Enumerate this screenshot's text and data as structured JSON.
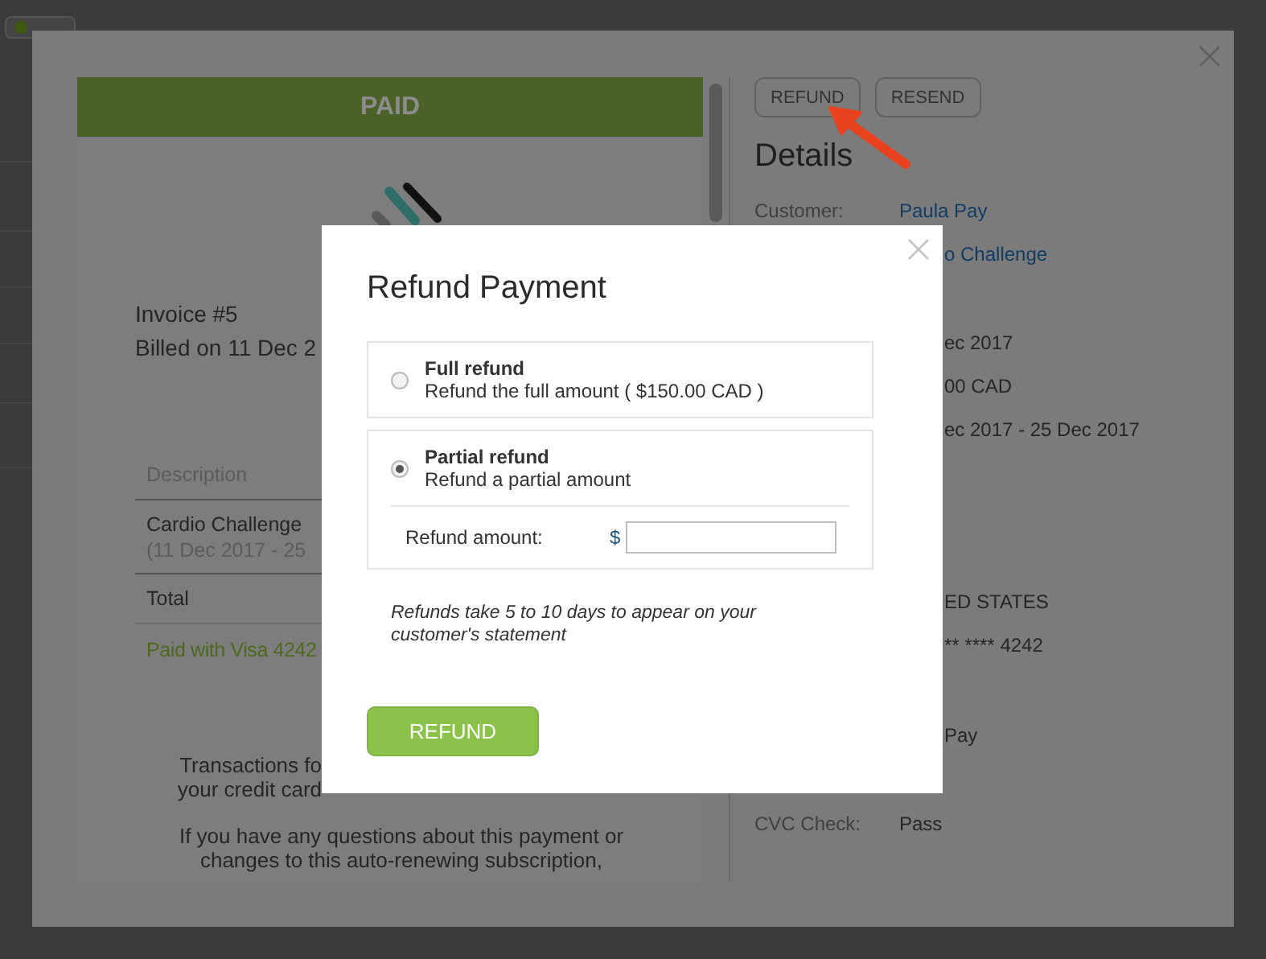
{
  "invoice": {
    "status": "PAID",
    "number": "Invoice #5",
    "billed": "Billed on 11 Dec 2",
    "table": {
      "header": "Description",
      "items": [
        {
          "name": "Cardio Challenge",
          "period": "(11 Dec 2017 - 25"
        }
      ],
      "total_label": "Total"
    },
    "payment": "Paid with Visa 4242",
    "footer": [
      [
        "Transactions fo",
        "your credit card"
      ],
      [
        "If you have any questions about this payment or",
        "changes to this auto-renewing subscription,"
      ]
    ]
  },
  "details_panel": {
    "actions": [
      "REFUND",
      "RESEND"
    ],
    "title": "Details",
    "groups": [
      [
        {
          "label": "Customer:",
          "value": "Paula Pay",
          "kind": "link"
        },
        {
          "value": "o Challenge",
          "kind": "link"
        }
      ],
      [
        {
          "value": "ec 2017",
          "kind": "text"
        },
        {
          "value": "00 CAD",
          "kind": "text"
        },
        {
          "value": "ec 2017 - 25 Dec 2017",
          "kind": "text"
        }
      ],
      [
        {
          "value": "ED STATES",
          "kind": "text"
        },
        {
          "value": "** **** 4242",
          "kind": "text"
        }
      ],
      [
        {
          "value": "Pay",
          "kind": "text"
        }
      ],
      [
        {
          "label": "CVC Check:",
          "value": "Pass",
          "kind": "text"
        }
      ]
    ]
  },
  "refund_dialog": {
    "title": "Refund Payment",
    "options": [
      {
        "title": "Full refund",
        "description": "Refund the full amount ( $150.00 CAD )",
        "selected": false
      },
      {
        "title": "Partial refund",
        "description": "Refund a partial amount",
        "selected": true,
        "amount": {
          "label": "Refund amount:",
          "currency": "$"
        }
      }
    ],
    "note": "Refunds take 5 to 10 days to appear on your customer's statement",
    "submit": "REFUND"
  }
}
